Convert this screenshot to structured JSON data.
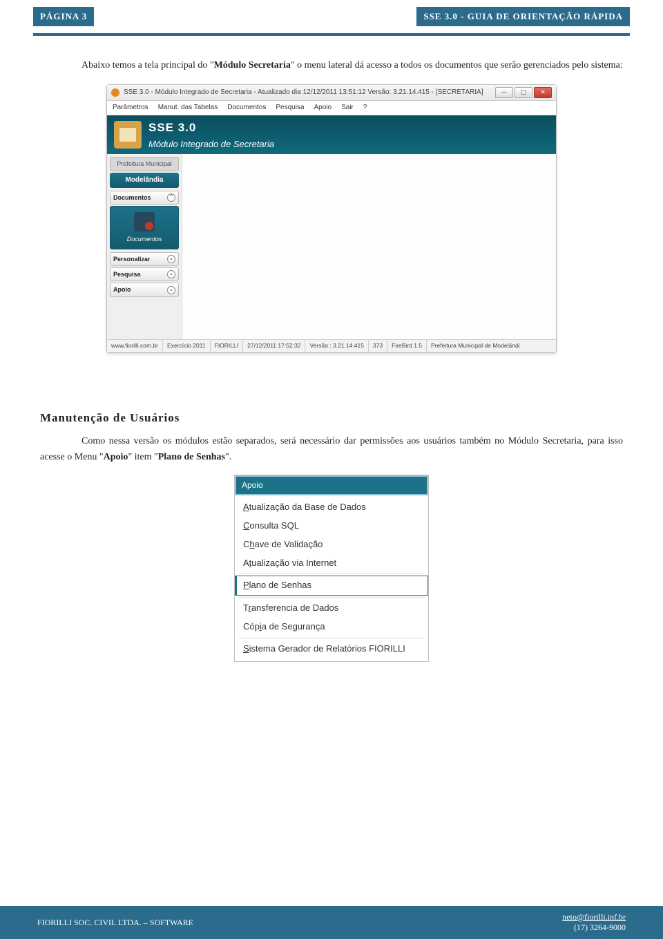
{
  "header": {
    "page_label": "PÁGINA 3",
    "doc_title": "SSE 3.0 - GUIA DE ORIENTAÇÃO RÁPIDA"
  },
  "intro": {
    "pre": "Abaixo temos a tela principal do ",
    "quote_open": "\"",
    "modulo": "Módulo Secretaria",
    "quote_close": "\"",
    "post": " o menu lateral dá acesso a todos os documentos que serão gerenciados pelo sistema:"
  },
  "window": {
    "title": "SSE 3.0 - Módulo Integrado de Secretaria - Atualizado dia 12/12/2011 13:51:12 Versão: 3.21.14.415 - [SECRETARIA]",
    "menubar": [
      "Parâmetros",
      "Manut. das Tabelas",
      "Documentos",
      "Pesquisa",
      "Apoio",
      "Sair",
      "?"
    ],
    "banner_line1": "SSE 3.0",
    "banner_line2": "Módulo Integrado de Secretaria",
    "sidebar": {
      "header": "Prefeitura Municipal",
      "municipality": "Modelândia",
      "sections": {
        "documentos": "Documentos",
        "documentos_item": "Documentos",
        "personalizar": "Personalizar",
        "pesquisa": "Pesquisa",
        "apoio": "Apoio"
      }
    },
    "status": {
      "url": "www.fiorilli.com.br",
      "exercicio": "Exercício 2011",
      "company": "FIORILLI",
      "datetime": "27/12/2011 17:52:32",
      "version": "Versão : 3.21.14.415",
      "code": "373",
      "db": "FireBird 1.5",
      "entity": "Prefeitura Municipal de Modelândi"
    }
  },
  "section2": {
    "title": "Manutenção de Usuários",
    "text_pre": "Como nessa versão os módulos estão separados, será necessário dar permissões aos usuários também no Módulo Secretaria, para isso acesse o Menu ",
    "quote_open": "\"",
    "menu": "Apoio",
    "middle": "\" item \"",
    "item": "Plano de Senhas",
    "quote_close": "\"."
  },
  "dropdown": {
    "header": "Apoio",
    "items": [
      {
        "label": "Atualização da  Base de Dados"
      },
      {
        "label": "Consulta SQL"
      },
      {
        "label": "Chave de Validação"
      },
      {
        "label": "Atualização via Internet"
      },
      {
        "label": "Plano de Senhas",
        "highlighted": true
      },
      {
        "label": "Transferencia de Dados"
      },
      {
        "label": "Cópia de Segurança"
      },
      {
        "label": "Sistema Gerador de Relatórios FIORILLI"
      }
    ]
  },
  "footer": {
    "left": "FIORILLI SOC. CIVIL LTDA. – SOFTWARE",
    "email": "neto@fiorilli.inf.br",
    "phone": "(17) 3264-9000"
  }
}
